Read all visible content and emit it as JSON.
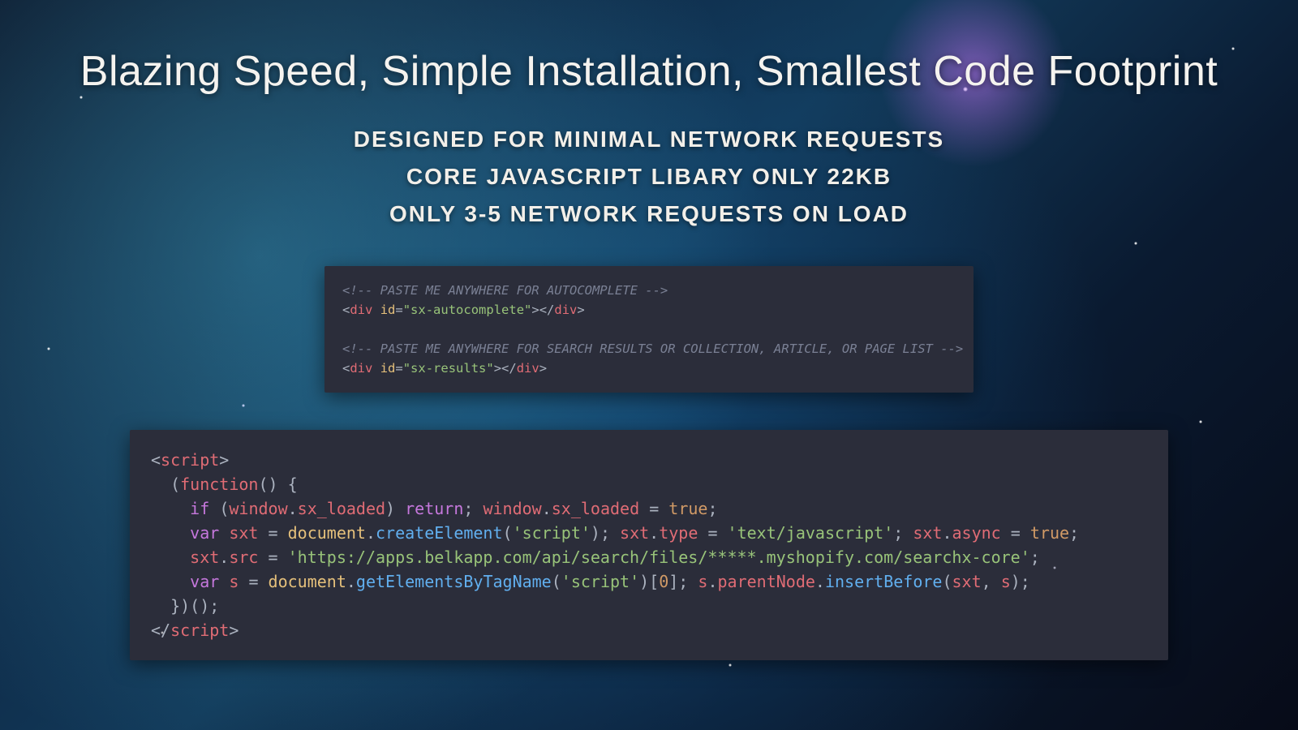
{
  "title": "Blazing Speed, Simple Installation, Smallest Code Footprint",
  "subtitles": [
    "DESIGNED FOR MINIMAL NETWORK REQUESTS",
    "CORE JAVASCRIPT LIBARY ONLY 22KB",
    "ONLY 3-5 NETWORK REQUESTS ON LOAD"
  ],
  "snippet_html": {
    "comment1": "<!-- PASTE ME ANYWHERE FOR AUTOCOMPLETE -->",
    "div1_id": "sx-autocomplete",
    "comment2": "<!-- PASTE ME ANYWHERE FOR SEARCH RESULTS OR COLLECTION, ARTICLE, OR PAGE LIST -->",
    "div2_id": "sx-results"
  },
  "snippet_js": {
    "open_tag": "script",
    "fn_open": "(function() {",
    "if_cond": "if (window.sx_loaded) return; window.sx_loaded = true;",
    "var_sxt": "var sxt = document.createElement('script'); sxt.type = 'text/javascript'; sxt.async = true;",
    "src_url": "https://apps.belkapp.com/api/search/files/*****.myshopify.com/searchx-core",
    "var_s": "var s = document.getElementsByTagName('script')[0]; s.parentNode.insertBefore(sxt, s);",
    "fn_close": "})();",
    "close_tag": "script"
  }
}
